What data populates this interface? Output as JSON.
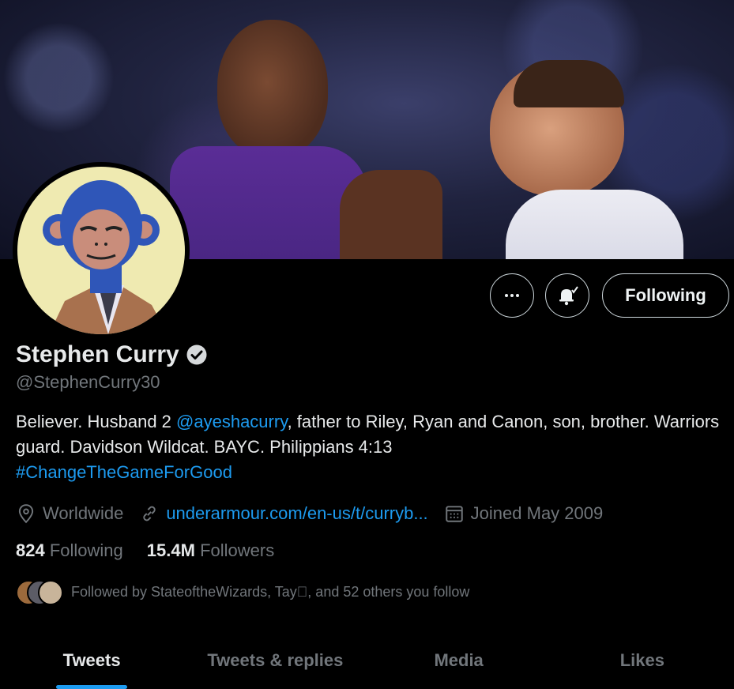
{
  "profile": {
    "name": "Stephen Curry",
    "handle": "@StephenCurry30",
    "bio_part1": "Believer. Husband 2 ",
    "bio_mention": "@ayeshacurry",
    "bio_part2": ", father to Riley, Ryan and Canon, son, brother. Warriors guard. Davidson Wildcat. BAYC. Philippians 4:13",
    "bio_hashtag": "#ChangeTheGameForGood",
    "location": "Worldwide",
    "website": "underarmour.com/en-us/t/curryb...",
    "joined": "Joined May 2009",
    "following_count": "824",
    "following_label": "Following",
    "followers_count": "15.4M",
    "followers_label": "Followers",
    "followed_by": "Followed by StateoftheWizards, Tay, and 52 others you follow"
  },
  "actions": {
    "following_button": "Following",
    "more_icon": "more-icon",
    "bell_icon": "notification-bell-icon"
  },
  "tabs": [
    {
      "label": "Tweets",
      "active": true
    },
    {
      "label": "Tweets & replies",
      "active": false
    },
    {
      "label": "Media",
      "active": false
    },
    {
      "label": "Likes",
      "active": false
    }
  ],
  "colors": {
    "accent": "#1d9bf0",
    "background": "#000000",
    "muted": "#71767b"
  }
}
